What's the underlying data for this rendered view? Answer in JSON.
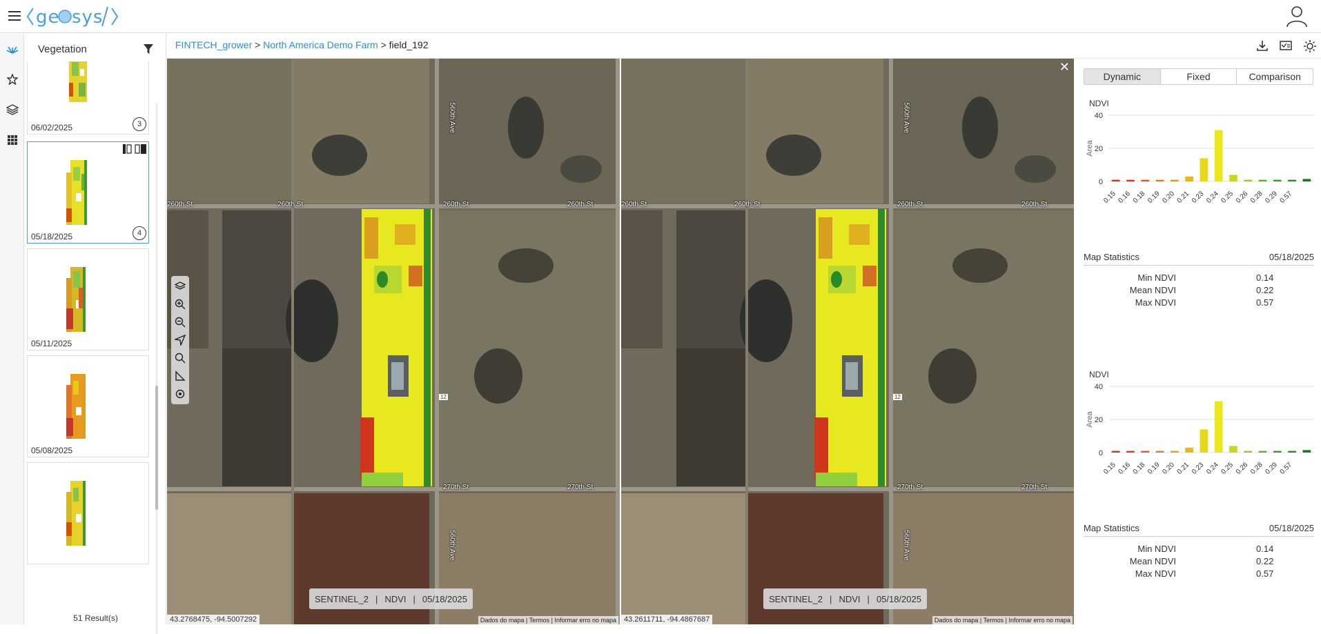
{
  "app": {
    "logo_text": "geosys/"
  },
  "nav": {
    "icons": [
      "vegetation-icon",
      "star-icon",
      "layers-icon",
      "grid-icon"
    ]
  },
  "panel": {
    "title": "Vegetation",
    "thumbnails": [
      {
        "date": "06/02/2025",
        "count": "3"
      },
      {
        "date": "05/18/2025",
        "count": "4",
        "selected": true
      },
      {
        "date": "05/11/2025",
        "count": ""
      },
      {
        "date": "05/08/2025",
        "count": ""
      },
      {
        "date": "",
        "count": ""
      }
    ],
    "results": "51 Result(s)"
  },
  "breadcrumb": {
    "grower": "FINTECH_grower",
    "farm": "North America Demo Farm",
    "field": "field_192",
    "sep": ">"
  },
  "maps": [
    {
      "coords": "43.2768475, -94.5007292",
      "sensor": "SENTINEL_2",
      "index": "NDVI",
      "date": "05/18/2025"
    },
    {
      "coords": "43.2611711, -94.4867687",
      "sensor": "SENTINEL_2",
      "index": "NDVI",
      "date": "05/18/2025"
    }
  ],
  "map_footer": {
    "data": "Dados do mapa",
    "terms": "Termos",
    "report": "Informar erro no mapa"
  },
  "roads": {
    "st260": "260th St",
    "st270": "270th St",
    "ave560": "560th Ave",
    "marker": "12"
  },
  "tabs": [
    "Dynamic",
    "Fixed",
    "Comparison"
  ],
  "chart_data": [
    {
      "type": "bar",
      "title": "NDVI",
      "ylabel": "Area",
      "ylim": [
        0,
        40
      ],
      "yticks": [
        0,
        20,
        40
      ],
      "categories": [
        "0.15",
        "0.16",
        "0.18",
        "0.19",
        "0.20",
        "0.21",
        "0.23",
        "0.24",
        "0.25",
        "0.26",
        "0.28",
        "0.29",
        "0.57"
      ],
      "values": [
        1,
        1,
        1,
        1,
        1,
        3,
        14,
        31,
        4,
        1,
        1,
        1,
        1,
        1.5
      ],
      "colors": [
        "#c0392b",
        "#d9381e",
        "#e0582a",
        "#e07a2a",
        "#e89a20",
        "#e8b81a",
        "#e8d81a",
        "#e8e81a",
        "#c8d820",
        "#9ac830",
        "#5ab030",
        "#3a9a2a",
        "#2a8a2a",
        "#1a7a1a"
      ],
      "bar_labels": [
        "0.15",
        "0.16",
        "0.18",
        "0.19",
        "0.20",
        "0.21",
        "0.23",
        "0.24",
        "0.25",
        "0.26",
        "0.28",
        "0.29",
        "0.57"
      ]
    },
    {
      "type": "bar",
      "title": "NDVI",
      "ylabel": "Area",
      "ylim": [
        0,
        40
      ],
      "yticks": [
        0,
        20,
        40
      ],
      "categories": [
        "0.15",
        "0.16",
        "0.18",
        "0.19",
        "0.20",
        "0.21",
        "0.23",
        "0.24",
        "0.25",
        "0.26",
        "0.28",
        "0.29",
        "0.57"
      ],
      "values": [
        1,
        1,
        1,
        1,
        1,
        3,
        14,
        31,
        4,
        1,
        1,
        1,
        1,
        1.5
      ],
      "colors": [
        "#c0392b",
        "#d9381e",
        "#e0582a",
        "#e07a2a",
        "#e89a20",
        "#e8b81a",
        "#e8d81a",
        "#e8e81a",
        "#c8d820",
        "#9ac830",
        "#5ab030",
        "#3a9a2a",
        "#2a8a2a",
        "#1a7a1a"
      ]
    }
  ],
  "stats": [
    {
      "title": "Map Statistics",
      "date": "05/18/2025",
      "rows": [
        {
          "name": "Min NDVI",
          "value": "0.14"
        },
        {
          "name": "Mean NDVI",
          "value": "0.22"
        },
        {
          "name": "Max NDVI",
          "value": "0.57"
        }
      ]
    },
    {
      "title": "Map Statistics",
      "date": "05/18/2025",
      "rows": [
        {
          "name": "Min NDVI",
          "value": "0.14"
        },
        {
          "name": "Mean NDVI",
          "value": "0.22"
        },
        {
          "name": "Max NDVI",
          "value": "0.57"
        }
      ]
    }
  ]
}
